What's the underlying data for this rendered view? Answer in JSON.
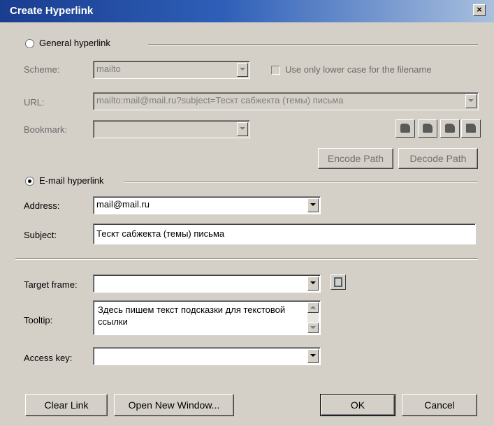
{
  "window": {
    "title": "Create Hyperlink",
    "close_label": "×"
  },
  "general": {
    "radio_label": "General hyperlink",
    "scheme": {
      "label": "Scheme:",
      "value": "mailto"
    },
    "lowercase_checkbox_label": "Use only lower case for the filename",
    "url": {
      "label": "URL:",
      "value": "mailto:mail@mail.ru?subject=Тескт сабжекта (темы) письма"
    },
    "bookmark": {
      "label": "Bookmark:",
      "value": ""
    },
    "bookmark_icons": [
      "folder-open-icon",
      "folder-icon",
      "browse-icon",
      "document-icon"
    ],
    "encode_label": "Encode Path",
    "decode_label": "Decode Path"
  },
  "email": {
    "radio_label": "E-mail hyperlink",
    "address": {
      "label": "Address:",
      "value": "mail@mail.ru"
    },
    "subject": {
      "label": "Subject:",
      "value": "Тескт сабжекта (темы) письма"
    }
  },
  "options": {
    "target_frame": {
      "label": "Target frame:",
      "value": ""
    },
    "tooltip": {
      "label": "Tooltip:",
      "value": "Здесь пишем текст подсказки для текстовой ссылки"
    },
    "access_key": {
      "label": "Access key:",
      "value": ""
    }
  },
  "buttons": {
    "clear": "Clear Link",
    "open_new_window": "Open New Window...",
    "ok": "OK",
    "cancel": "Cancel"
  }
}
